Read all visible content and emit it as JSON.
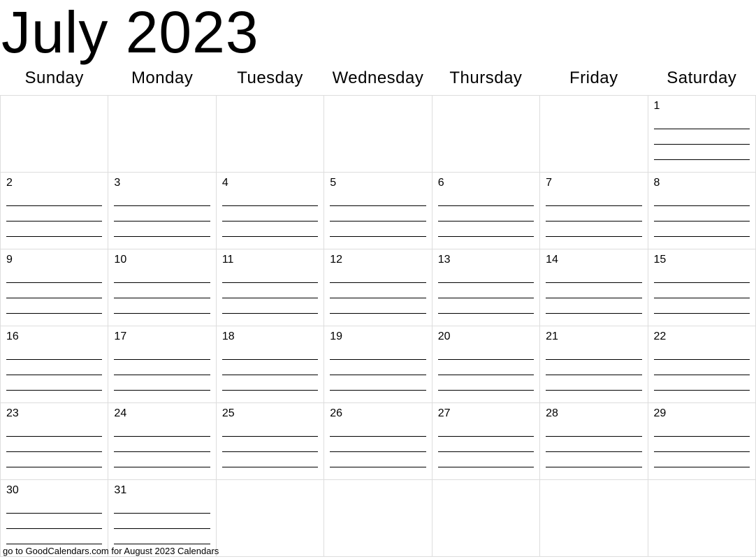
{
  "title": "July 2023",
  "weekdays": [
    "Sunday",
    "Monday",
    "Tuesday",
    "Wednesday",
    "Thursday",
    "Friday",
    "Saturday"
  ],
  "weeks": [
    [
      null,
      null,
      null,
      null,
      null,
      null,
      "1"
    ],
    [
      "2",
      "3",
      "4",
      "5",
      "6",
      "7",
      "8"
    ],
    [
      "9",
      "10",
      "11",
      "12",
      "13",
      "14",
      "15"
    ],
    [
      "16",
      "17",
      "18",
      "19",
      "20",
      "21",
      "22"
    ],
    [
      "23",
      "24",
      "25",
      "26",
      "27",
      "28",
      "29"
    ],
    [
      "30",
      "31",
      null,
      null,
      null,
      null,
      null
    ]
  ],
  "footer": "go to GoodCalendars.com for August 2023 Calendars"
}
